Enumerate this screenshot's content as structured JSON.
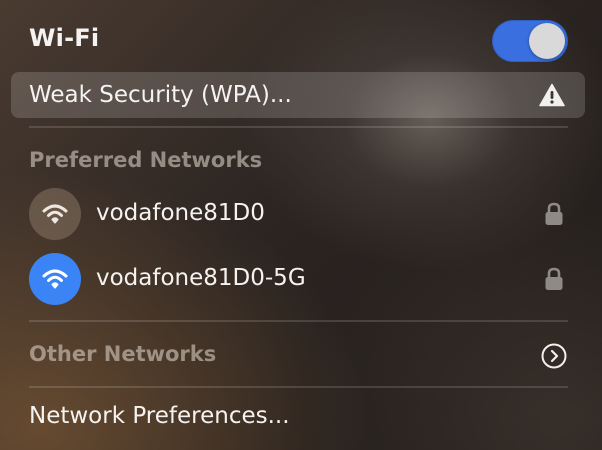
{
  "wifi": {
    "title": "Wi-Fi",
    "enabled": true,
    "accent_color": "#3a6fe0"
  },
  "current_network": {
    "label": "Weak Security (WPA)...",
    "warning_icon": "warning-triangle-icon"
  },
  "preferred": {
    "header": "Preferred Networks",
    "networks": [
      {
        "name": "vodafone81D0",
        "connected": false,
        "secured": true,
        "icon": "wifi-icon",
        "lock_icon": "lock-icon"
      },
      {
        "name": "vodafone81D0-5G",
        "connected": true,
        "secured": true,
        "icon": "wifi-icon",
        "lock_icon": "lock-icon",
        "icon_color": "#3a84f6"
      }
    ]
  },
  "other": {
    "label": "Other Networks",
    "icon": "chevron-right-circle-icon"
  },
  "preferences": {
    "label": "Network Preferences..."
  }
}
